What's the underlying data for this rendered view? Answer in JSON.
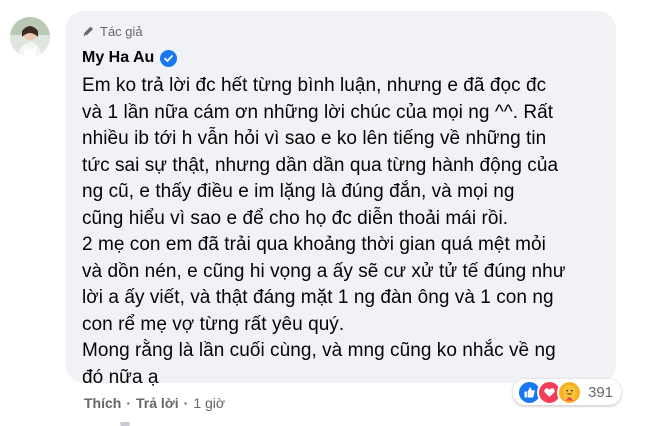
{
  "comment": {
    "author_badge": "Tác giả",
    "author_name": "My Ha Au",
    "text_lines": [
      "Em ko trả lời đc hết từng bình luận, nhưng e đã đọc đc",
      "và 1 lần nữa cám ơn những lời chúc của mọi ng ^^. Rất",
      "nhiều ib tới h vẫn hỏi vì sao e ko lên tiếng về những tin",
      "tức sai sự thật, nhưng dần dần qua từng hành động của",
      "ng cũ, e thấy điều e im lặng là đúng đắn, và mọi ng",
      "cũng hiểu vì sao e để cho họ đc diễn thoải mái rồi.",
      "2 mẹ con em đã trải qua khoảng thời gian quá mệt mỏi",
      "và dồn nén, e cũng hi vọng a ấy sẽ cư xử tử tế đúng như",
      "lời a ấy viết, và thật đáng mặt 1 ng đàn ông và 1 con ng",
      "con rể mẹ vợ từng rất yêu quý.",
      "Mong rằng là lần cuối cùng, và mng cũng ko nhắc về ng",
      "đó nữa ạ"
    ],
    "reactions": {
      "icons": [
        "like-icon",
        "love-icon",
        "care-icon"
      ],
      "count": "391"
    },
    "actions": {
      "like_label": "Thích",
      "reply_label": "Trả lời",
      "separator": "·",
      "time": "1 giờ"
    }
  },
  "colors": {
    "bubble_bg": "#f0f2f5",
    "secondary_text": "#65676b",
    "primary_text": "#050505",
    "verified_blue": "#1877f2"
  }
}
